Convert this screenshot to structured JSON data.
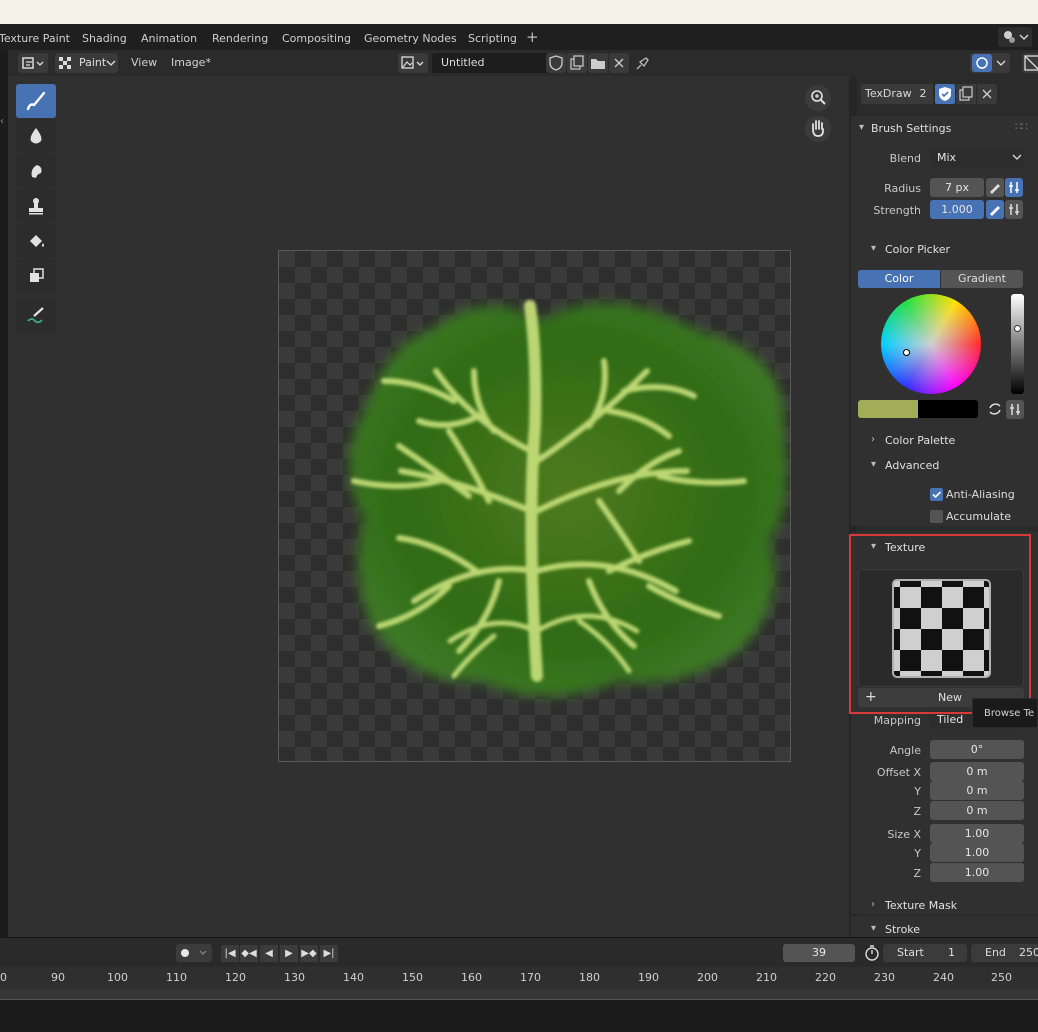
{
  "workspace_tabs": [
    "Texture Paint",
    "Shading",
    "Animation",
    "Rendering",
    "Compositing",
    "Geometry Nodes",
    "Scripting"
  ],
  "add_tab": "+",
  "header": {
    "mode": "Paint",
    "menus": [
      "View",
      "Image*"
    ],
    "image_name": "Untitled"
  },
  "panel": {
    "brush_name": "TexDraw",
    "brush_users": "2",
    "brush_settings": {
      "title": "Brush Settings",
      "blend_label": "Blend",
      "blend_value": "Mix",
      "radius_label": "Radius",
      "radius_value": "7 px",
      "strength_label": "Strength",
      "strength_value": "1.000"
    },
    "color_picker": {
      "title": "Color Picker",
      "tabs": [
        "Color",
        "Gradient"
      ],
      "primary_color": "#a3ad58",
      "secondary_color": "#000000"
    },
    "color_palette": "Color Palette",
    "advanced": {
      "title": "Advanced",
      "anti_aliasing": "Anti-Aliasing",
      "accumulate": "Accumulate"
    },
    "texture": {
      "title": "Texture",
      "new_label": "New",
      "new_plus": "+",
      "tooltip": "Browse Te",
      "mapping_label": "Mapping",
      "mapping_value": "Tiled",
      "angle_label": "Angle",
      "angle_value": "0°",
      "offset_x_label": "Offset X",
      "offset_x": "0 m",
      "offset_y_label": "Y",
      "offset_y": "0 m",
      "offset_z_label": "Z",
      "offset_z": "0 m",
      "size_x_label": "Size X",
      "size_x": "1.00",
      "size_y_label": "Y",
      "size_y": "1.00",
      "size_z_label": "Z",
      "size_z": "1.00"
    },
    "texture_mask": "Texture Mask",
    "stroke": "Stroke"
  },
  "timeline": {
    "current_frame": "39",
    "start_label": "Start",
    "start_value": "1",
    "end_label": "End",
    "end_value": "250",
    "ruler": [
      "0",
      "90",
      "100",
      "110",
      "120",
      "130",
      "140",
      "150",
      "160",
      "170",
      "180",
      "190",
      "200",
      "210",
      "220",
      "230",
      "240",
      "250"
    ]
  },
  "colors": {
    "accent": "#4772b3",
    "highlight_box": "#d83a3a"
  }
}
